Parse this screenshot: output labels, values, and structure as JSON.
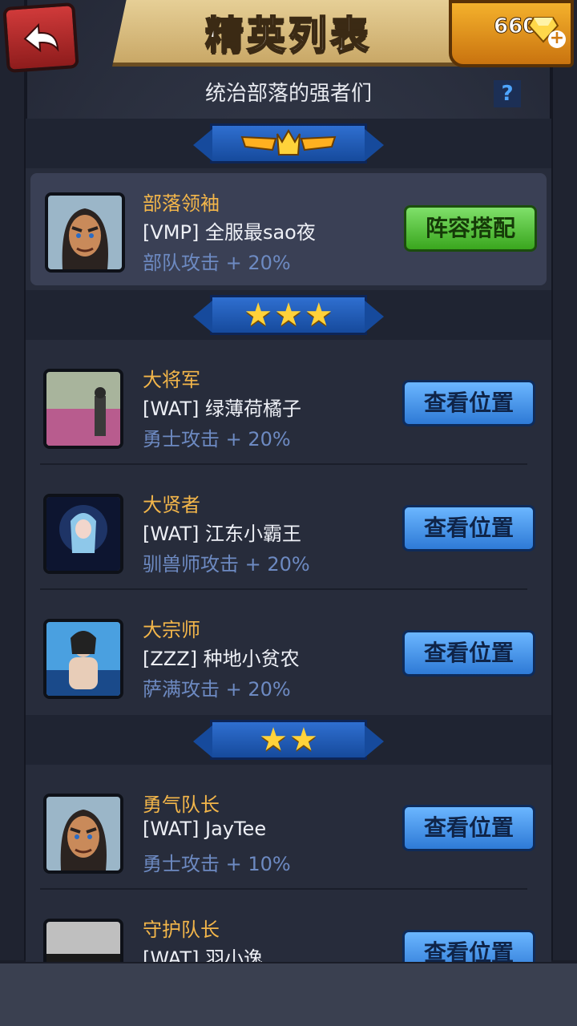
{
  "header": {
    "title": "精英列表",
    "gems": "660",
    "subtitle": "统治部落的强者们",
    "help": "?"
  },
  "tiers": [
    {
      "stars": 0,
      "rows": [
        {
          "rank": "部落领袖",
          "name": "[VMP] 全服最sao夜",
          "buff": "部队攻击 + 20%",
          "button": "阵容搭配",
          "avatar": "warrior"
        }
      ]
    },
    {
      "stars": 3,
      "rows": [
        {
          "rank": "大将军",
          "name": "[WAT] 绿薄荷橘子",
          "buff": "勇士攻击 + 20%",
          "button": "查看位置",
          "avatar": "field"
        },
        {
          "rank": "大贤者",
          "name": "[WAT] 江东小霸王",
          "buff": "驯兽师攻击 + 20%",
          "button": "查看位置",
          "avatar": "anime"
        },
        {
          "rank": "大宗师",
          "name": "[ZZZ] 种地小贫农",
          "buff": "萨满攻击 + 20%",
          "button": "查看位置",
          "avatar": "fighter"
        }
      ]
    },
    {
      "stars": 2,
      "rows": [
        {
          "rank": "勇气队长",
          "name": "[WAT] JayTee",
          "buff": "勇士攻击 + 10%",
          "button": "查看位置",
          "avatar": "warrior"
        },
        {
          "rank": "守护队长",
          "name": "[WAT] 羽小逸",
          "buff": "",
          "button": "查看位置",
          "avatar": "car"
        }
      ]
    }
  ],
  "colors": {
    "rank": "#f3b64a",
    "buff": "#6d8ac2",
    "leader_button": "#3aa61e",
    "view_button": "#2e7ad6"
  }
}
